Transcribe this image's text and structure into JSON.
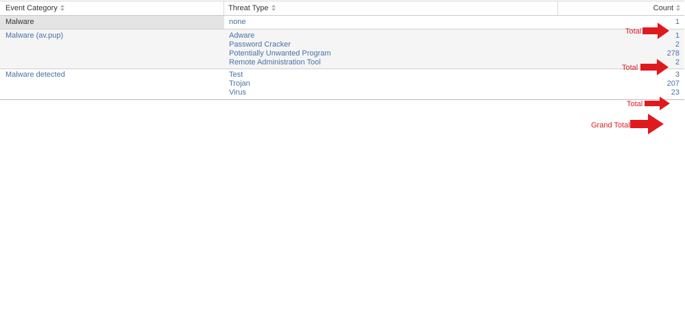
{
  "table": {
    "columns": [
      {
        "label": "Event Category"
      },
      {
        "label": "Threat Type"
      },
      {
        "label": "Count"
      }
    ],
    "rows": [
      {
        "category": "Malware",
        "items": [
          {
            "type": "none",
            "count": "1"
          }
        ]
      },
      {
        "category": "Malware (av.pup)",
        "items": [
          {
            "type": "Adware",
            "count": "1"
          },
          {
            "type": "Password Cracker",
            "count": "2"
          },
          {
            "type": "Potentially Unwanted Program",
            "count": "278"
          },
          {
            "type": "Remote Administration Tool",
            "count": "2"
          }
        ]
      },
      {
        "category": "Malware detected",
        "items": [
          {
            "type": "Test",
            "count": "3"
          },
          {
            "type": "Trojan",
            "count": "207"
          },
          {
            "type": "Virus",
            "count": "23"
          }
        ]
      }
    ]
  },
  "annotations": {
    "total_1": "Total",
    "total_2": "Total",
    "total_3": "Total",
    "grand_total": "Grand Total",
    "color": "#e0191e"
  },
  "icons": {
    "sort": "sort-arrows-icon",
    "arrow": "red-arrow-right-icon"
  },
  "colors": {
    "link": "#4a6fa5",
    "header_text": "#333333",
    "selected_cell_bg": "#e4e4e4",
    "alt_row_bg": "#f5f5f5"
  }
}
